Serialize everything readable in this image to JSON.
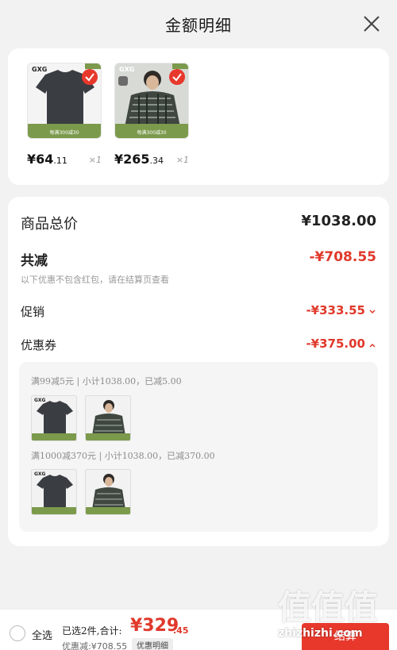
{
  "header": {
    "title": "金额明细",
    "close_icon": "close-icon"
  },
  "products": [
    {
      "brand": "GXG",
      "band_text": "每满300减30",
      "price_main": "¥64",
      "price_cents": ".11",
      "qty": "×1",
      "image": "black-tshirt"
    },
    {
      "brand": "GXG",
      "band_text": "每满300减30",
      "price_main": "¥265",
      "price_cents": ".34",
      "qty": "×1",
      "image": "plaid-jacket-model"
    }
  ],
  "summary": {
    "total_label": "商品总价",
    "total_value": "¥1038.00",
    "reduce_label": "共减",
    "reduce_value": "-¥708.55",
    "reduce_note": "以下优惠不包含红包，请在结算页查看",
    "promo_label": "促销",
    "promo_value": "-¥333.55",
    "coupon_label": "优惠券",
    "coupon_value": "-¥375.00"
  },
  "coupon_rules": [
    {
      "text": "满99减5元 | 小计1038.00，已减5.00"
    },
    {
      "text": "满1000减370元 | 小计1038.00，已减370.00"
    }
  ],
  "bottom": {
    "select_all": "全选",
    "selected_info": "已选2件,合计:",
    "total_main": "¥329",
    "total_cents": ".45",
    "discount_info": "优惠减:¥708.55",
    "detail_chip": "优惠明细",
    "checkout": "结算"
  },
  "watermark": {
    "logo": "值值值",
    "url": "zhizhizhi.com"
  },
  "colors": {
    "accent": "#e0392b",
    "band": "#7c9a4c",
    "check": "#e8382c"
  }
}
